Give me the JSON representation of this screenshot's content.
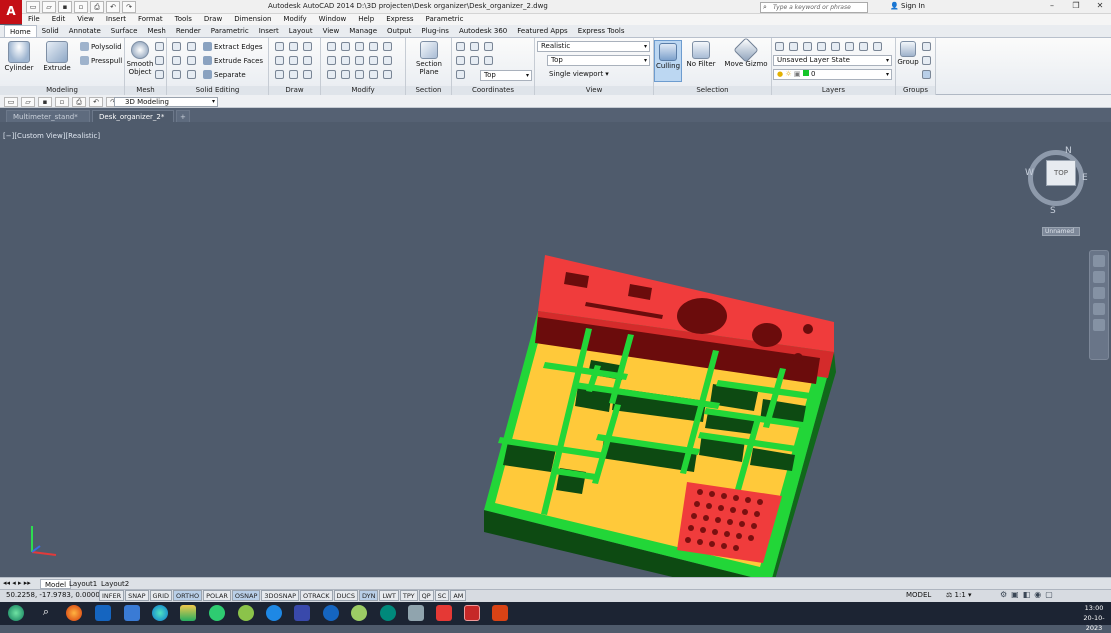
{
  "window": {
    "app_logo": "A",
    "title": "Autodesk AutoCAD 2014    D:\\3D projecten\\Desk organizer\\Desk_organizer_2.dwg",
    "search_placeholder": "Type a keyword or phrase",
    "sign_in": "Sign In",
    "controls": [
      "–",
      "❐",
      "✕"
    ]
  },
  "menu": [
    "File",
    "Edit",
    "View",
    "Insert",
    "Format",
    "Tools",
    "Draw",
    "Dimension",
    "Modify",
    "Window",
    "Help",
    "Express",
    "Parametric"
  ],
  "ribbon_tabs": [
    "Home",
    "Solid",
    "Annotate",
    "Surface",
    "Mesh",
    "Render",
    "Parametric",
    "Insert",
    "Layout",
    "View",
    "Manage",
    "Output",
    "Plug-ins",
    "Autodesk 360",
    "Featured Apps",
    "Express Tools"
  ],
  "ribbon": {
    "modeling": {
      "cylinder": "Cylinder",
      "extrude": "Extrude",
      "polysolid": "Polysolid",
      "presspull": "Presspull",
      "label": "Modeling"
    },
    "mesh": {
      "smooth": "Smooth",
      "object": "Object",
      "label": "Mesh"
    },
    "solid_editing": {
      "extract_edges": "Extract Edges",
      "extrude_faces": "Extrude Faces",
      "separate": "Separate",
      "label": "Solid Editing"
    },
    "draw": {
      "label": "Draw"
    },
    "modify": {
      "label": "Modify"
    },
    "section": {
      "section": "Section",
      "plane": "Plane",
      "label": "Section"
    },
    "coordinates": {
      "ucs": "Top",
      "label": "Coordinates"
    },
    "view": {
      "visual_style": "Realistic",
      "view_name": "Top",
      "viewport": "Single viewport",
      "label": "View"
    },
    "selection": {
      "culling": "Culling",
      "no_filter": "No Filter",
      "move_gizmo": "Move Gizmo",
      "label": "Selection"
    },
    "layers": {
      "layer_state": "Unsaved Layer State",
      "current_layer": "0",
      "label": "Layers"
    },
    "groups": {
      "group": "Group",
      "label": "Groups"
    }
  },
  "workspace": "3D Modeling",
  "file_tabs": [
    "Multimeter_stand*",
    "Desk_organizer_2*"
  ],
  "viewport": {
    "label": "[−][Custom View][Realistic]",
    "viewcube_face": "TOP",
    "compass": {
      "n": "N",
      "e": "E",
      "s": "S",
      "w": "W"
    },
    "ucs_name": "Unnamed"
  },
  "layout_tabs": [
    "Model",
    "Layout1",
    "Layout2"
  ],
  "status": {
    "coords": "50.2258, -17.9783, 0.0000",
    "toggles": [
      {
        "label": "INFER",
        "on": false
      },
      {
        "label": "SNAP",
        "on": false
      },
      {
        "label": "GRID",
        "on": false
      },
      {
        "label": "ORTHO",
        "on": true
      },
      {
        "label": "POLAR",
        "on": false
      },
      {
        "label": "OSNAP",
        "on": true
      },
      {
        "label": "3DOSNAP",
        "on": false
      },
      {
        "label": "OTRACK",
        "on": false
      },
      {
        "label": "DUCS",
        "on": false
      },
      {
        "label": "DYN",
        "on": true
      },
      {
        "label": "LWT",
        "on": false
      },
      {
        "label": "TPY",
        "on": false
      },
      {
        "label": "QP",
        "on": false
      },
      {
        "label": "SC",
        "on": false
      },
      {
        "label": "AM",
        "on": false
      }
    ],
    "model": "MODEL",
    "scale": "1:1"
  },
  "taskbar": {
    "time": "13:00",
    "date": "20-10-2023"
  },
  "colors": {
    "red": "#f03c3c",
    "green": "#22d638",
    "yellow": "#ffc93a",
    "dark_green": "#0d4a12",
    "dark_red": "#6b0c0c",
    "viewport_bg": "#4f5b6c"
  }
}
